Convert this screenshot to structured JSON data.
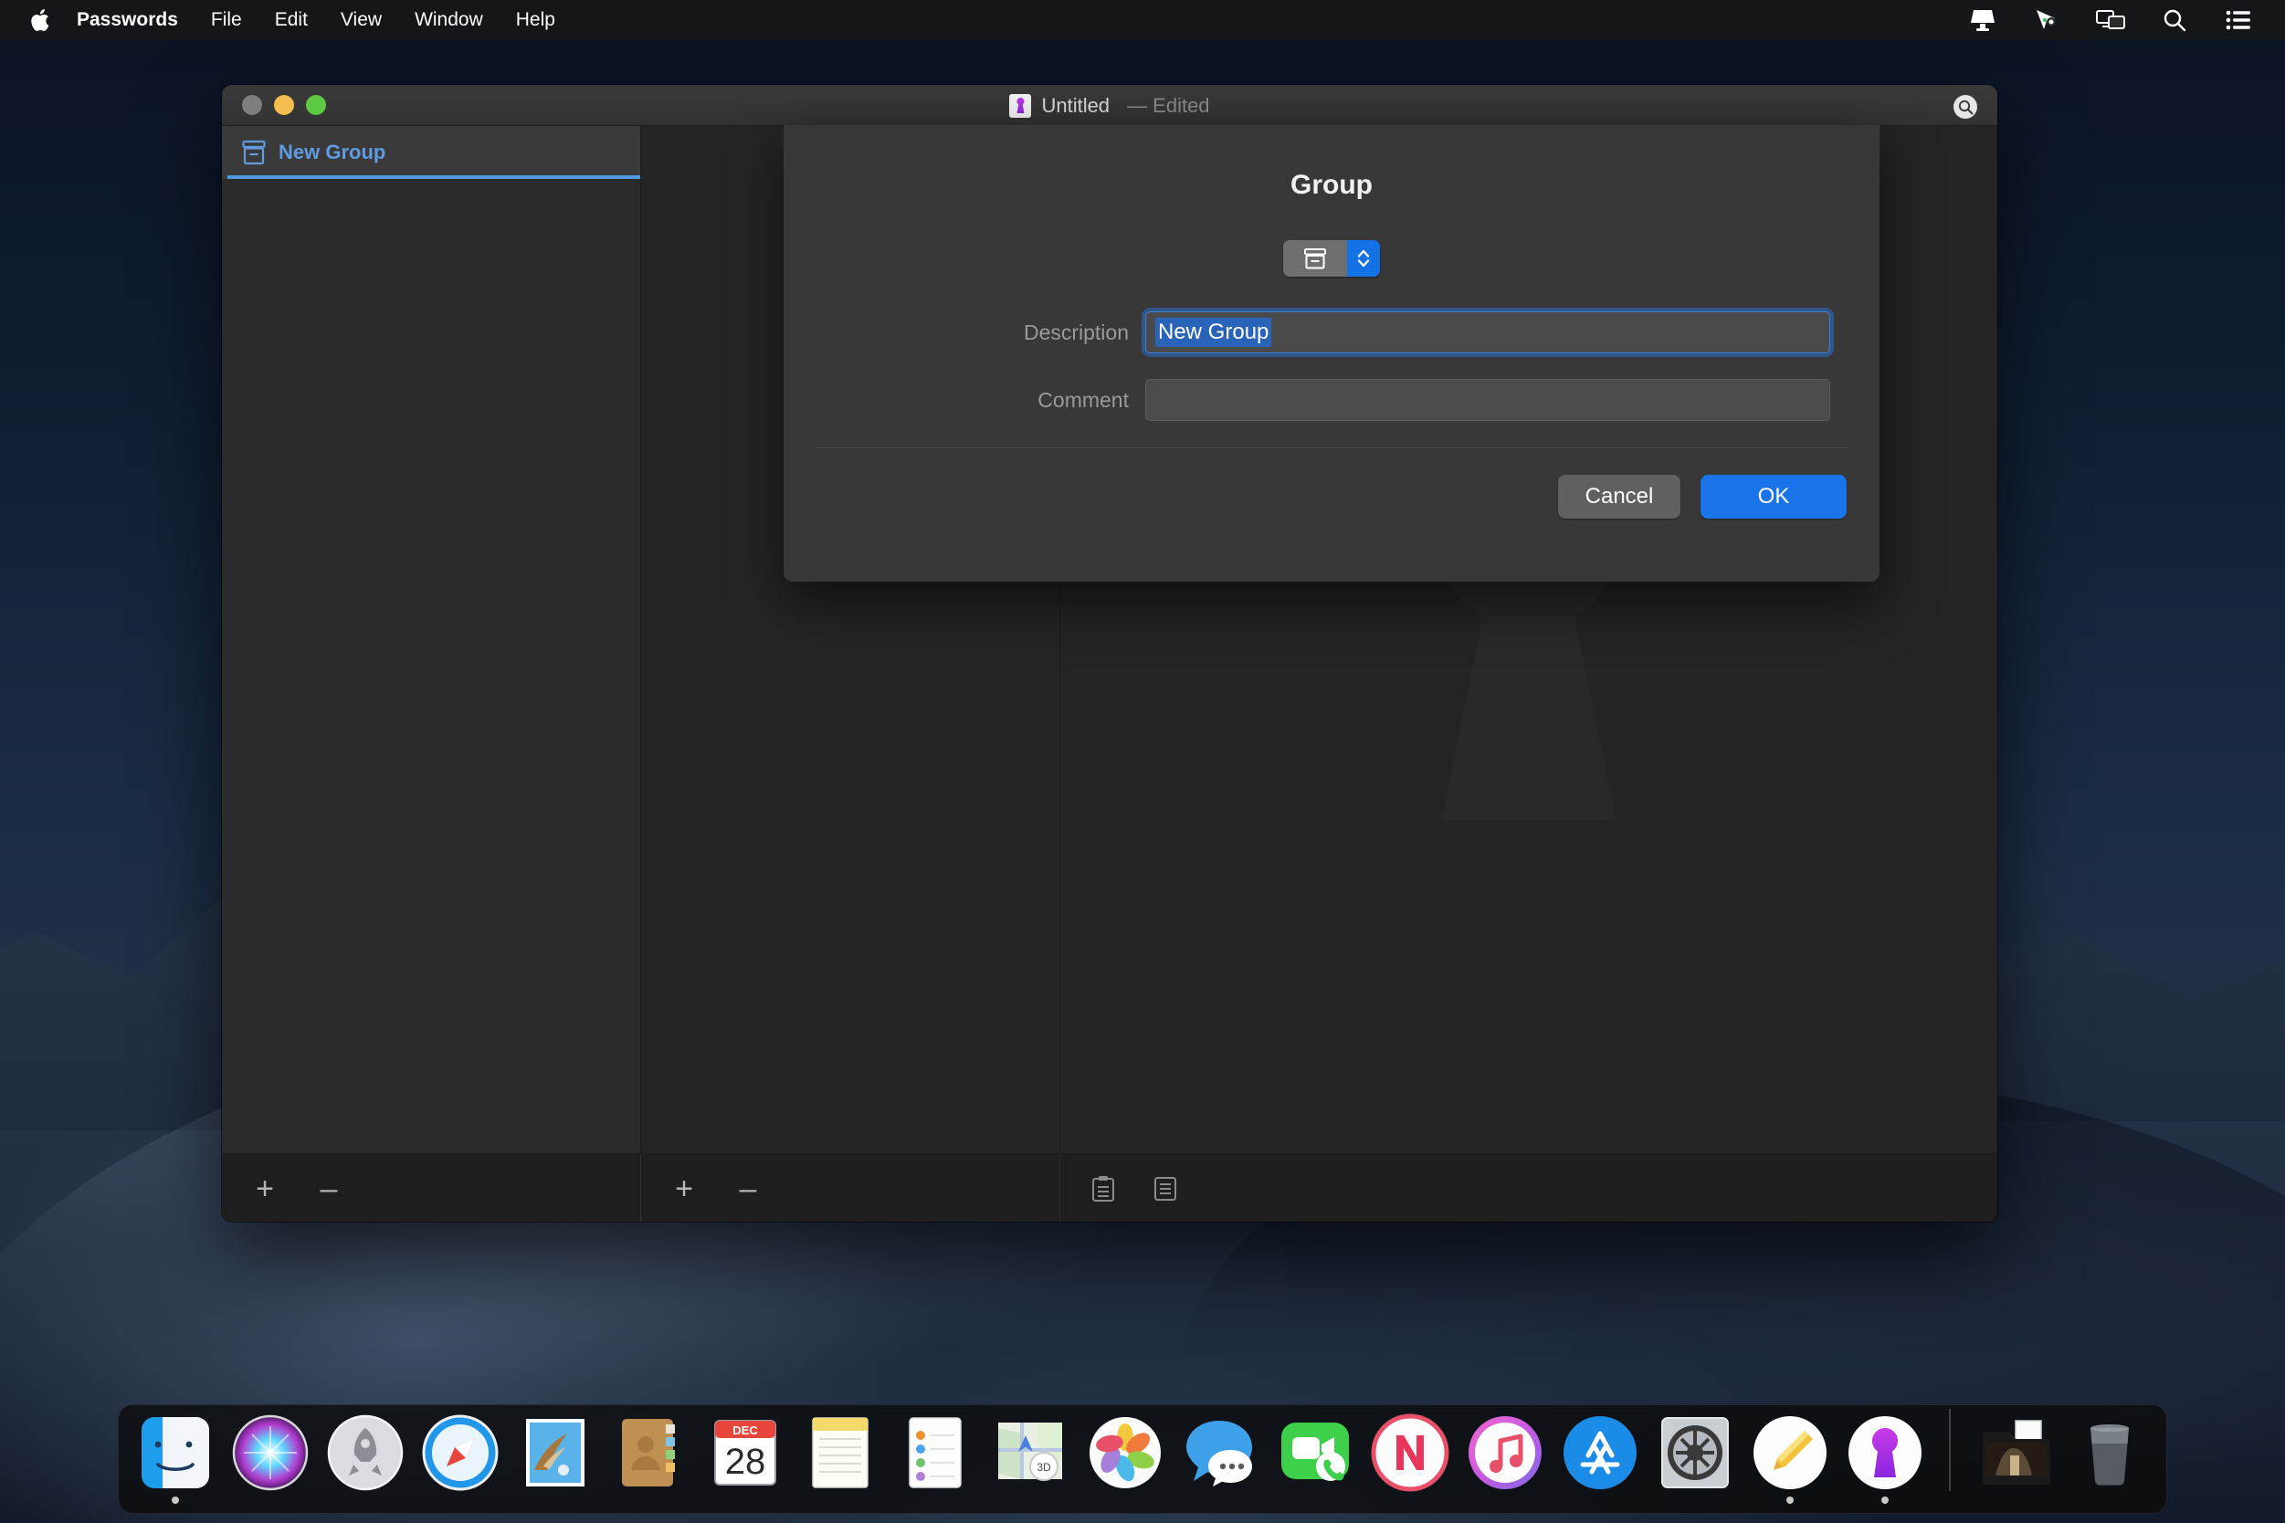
{
  "menubar": {
    "apple_icon": "apple-logo",
    "items": [
      {
        "label": "Passwords",
        "bold": true
      },
      {
        "label": "File",
        "bold": false
      },
      {
        "label": "Edit",
        "bold": false
      },
      {
        "label": "View",
        "bold": false
      },
      {
        "label": "Window",
        "bold": false
      },
      {
        "label": "Help",
        "bold": false
      }
    ],
    "status_icons": [
      {
        "name": "display-icon"
      },
      {
        "name": "pointer-icon"
      },
      {
        "name": "screen-mirroring-icon"
      },
      {
        "name": "spotlight-search-icon"
      },
      {
        "name": "control-center-icon"
      }
    ]
  },
  "window": {
    "title": "Untitled",
    "edited_suffix": "— Edited",
    "proxy_icon": "keyhole-document-icon",
    "search_icon": "search-icon",
    "traffic_lights": [
      "close",
      "minimize",
      "zoom"
    ]
  },
  "sidebar": {
    "items": [
      {
        "label": "New Group",
        "icon": "group-box-icon",
        "selected": true
      }
    ]
  },
  "bottom_bar": {
    "segment1": [
      {
        "name": "add-group-button",
        "glyph": "+"
      },
      {
        "name": "remove-group-button",
        "glyph": "–"
      }
    ],
    "segment2": [
      {
        "name": "add-entry-button",
        "glyph": "+"
      },
      {
        "name": "remove-entry-button",
        "glyph": "–"
      }
    ],
    "segment3": [
      {
        "name": "clipboard-icon"
      },
      {
        "name": "notes-icon"
      }
    ]
  },
  "sheet": {
    "title": "Group",
    "popup": {
      "icon": "group-box-icon",
      "arrows": "chevron-updown-icon"
    },
    "fields": [
      {
        "label": "Description",
        "value": "New Group",
        "placeholder": "",
        "focused": true,
        "selected": true
      },
      {
        "label": "Comment",
        "value": "",
        "placeholder": "",
        "focused": false,
        "selected": false
      }
    ],
    "buttons": [
      {
        "label": "Cancel",
        "kind": "secondary"
      },
      {
        "label": "OK",
        "kind": "primary"
      }
    ]
  },
  "dock": {
    "items": [
      {
        "name": "finder",
        "label": "Finder",
        "running": true
      },
      {
        "name": "siri",
        "label": "Siri",
        "running": false
      },
      {
        "name": "launchpad",
        "label": "Launchpad",
        "running": false
      },
      {
        "name": "safari",
        "label": "Safari",
        "running": false
      },
      {
        "name": "mail",
        "label": "Mail",
        "running": false
      },
      {
        "name": "contacts",
        "label": "Contacts",
        "running": false
      },
      {
        "name": "calendar",
        "label": "Calendar",
        "running": false,
        "month": "DEC",
        "day": "28"
      },
      {
        "name": "notes",
        "label": "Notes",
        "running": false
      },
      {
        "name": "reminders",
        "label": "Reminders",
        "running": false
      },
      {
        "name": "maps",
        "label": "Maps",
        "running": false,
        "badge": "3D"
      },
      {
        "name": "photos",
        "label": "Photos",
        "running": false
      },
      {
        "name": "messages",
        "label": "Messages",
        "running": false
      },
      {
        "name": "facetime",
        "label": "FaceTime",
        "running": false
      },
      {
        "name": "news",
        "label": "News",
        "running": false
      },
      {
        "name": "itunes",
        "label": "iTunes",
        "running": false
      },
      {
        "name": "app-store",
        "label": "App Store",
        "running": false
      },
      {
        "name": "system-preferences",
        "label": "System Preferences",
        "running": false
      },
      {
        "name": "pencil-app",
        "label": "Pencil",
        "running": true
      },
      {
        "name": "passwords",
        "label": "Passwords",
        "running": true
      }
    ],
    "stack_items": [
      {
        "name": "downloads-stack",
        "label": "Downloads"
      },
      {
        "name": "trash",
        "label": "Trash"
      }
    ]
  },
  "colors": {
    "accent_blue": "#1874e8",
    "selection_blue": "#2a64b8",
    "sidebar_label_blue": "#5f9bdd",
    "keyhole_purple": "#b23ce0",
    "window_bg": "#282828",
    "sheet_bg": "#383838"
  }
}
